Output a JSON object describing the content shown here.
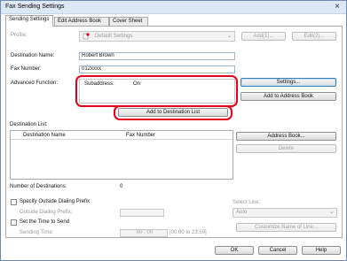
{
  "window": {
    "title": "Fax Sending Settings",
    "close_glyph": "×"
  },
  "tabs": [
    {
      "label": "Sending Settings",
      "active": true
    },
    {
      "label": "Edit Address Book",
      "active": false
    },
    {
      "label": "Cover Sheet",
      "active": false
    }
  ],
  "profile": {
    "label": "Profile:",
    "value": "Default Settings",
    "add_label": "Add(1)...",
    "edit_label": "Edit(2)..."
  },
  "destination": {
    "name_label": "Destination Name:",
    "name_value": "Robert Brown",
    "fax_label": "Fax Number:",
    "fax_value": "012xxxx"
  },
  "advanced": {
    "label": "Advanced Function:",
    "subaddress_label": "Subaddress:",
    "subaddress_value": "On",
    "settings_label": "Settings...",
    "add_to_book_label": "Add to Address Book"
  },
  "add_to_list_label": "Add to Destination List",
  "destination_list": {
    "label": "Destination List:",
    "col_name": "Destination Name",
    "col_fax": "Fax Number",
    "address_book_label": "Address Book...",
    "delete_label": "Delete",
    "count_label": "Number of Destinations:",
    "count_value": "0"
  },
  "dialing": {
    "specify_label": "Specify Outside Dialing Prefix",
    "prefix_label": "Outside Dialing Prefix:",
    "select_line_label": "Select Line:",
    "select_line_value": "Auto",
    "set_time_label": "Set the Time to Send",
    "sending_time_label": "Sending Time:",
    "hour": "00",
    "minute": "00",
    "range": "[00:00 to 23:59]",
    "customize_label": "Customize Name of Line..."
  },
  "footer": {
    "ok": "OK",
    "cancel": "Cancel",
    "help": "Help"
  },
  "colors": {
    "highlight": "#e3001b",
    "title_bg": "#dce8f5"
  }
}
